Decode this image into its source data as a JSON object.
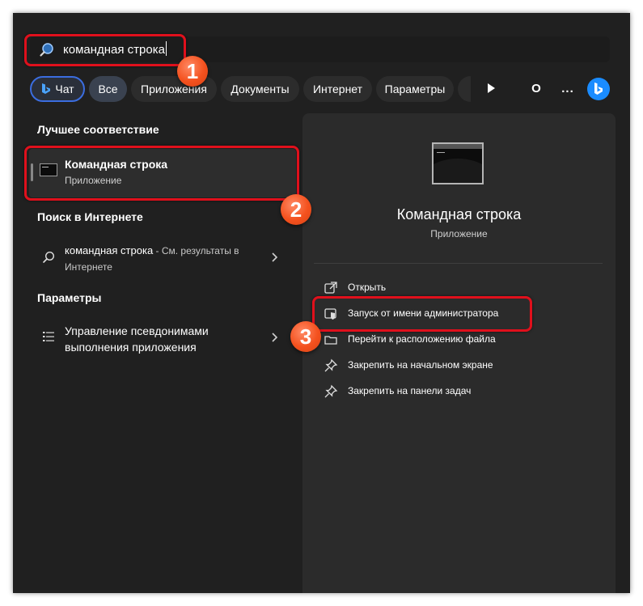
{
  "search": {
    "query": "командная строка"
  },
  "filters": {
    "chat": "Чат",
    "all": "Все",
    "apps": "Приложения",
    "docs": "Документы",
    "internet": "Интернет",
    "params": "Параметры",
    "more_glyph": "...",
    "avatar_letter": "О"
  },
  "best_match": {
    "section": "Лучшее соответствие",
    "title": "Командная строка",
    "subtitle": "Приложение"
  },
  "web": {
    "section": "Поиск в Интернете",
    "query": "командная строка",
    "suffix": " - См. результаты в Интернете"
  },
  "settings": {
    "section": "Параметры",
    "item": "Управление псевдонимами выполнения приложения"
  },
  "details": {
    "title": "Командная строка",
    "subtitle": "Приложение",
    "actions": [
      {
        "label": "Открыть",
        "icon": "open-external-icon"
      },
      {
        "label": "Запуск от имени администратора",
        "icon": "shield-admin-icon"
      },
      {
        "label": "Перейти к расположению файла",
        "icon": "folder-icon"
      },
      {
        "label": "Закрепить на начальном экране",
        "icon": "pin-icon"
      },
      {
        "label": "Закрепить на панели задач",
        "icon": "pin-icon"
      }
    ]
  },
  "badges": [
    "1",
    "2",
    "3"
  ],
  "colors": {
    "highlight": "#e0101c",
    "badge": "#f4511e",
    "chat_border": "#3b6de0",
    "bing": "#1a8cff"
  }
}
